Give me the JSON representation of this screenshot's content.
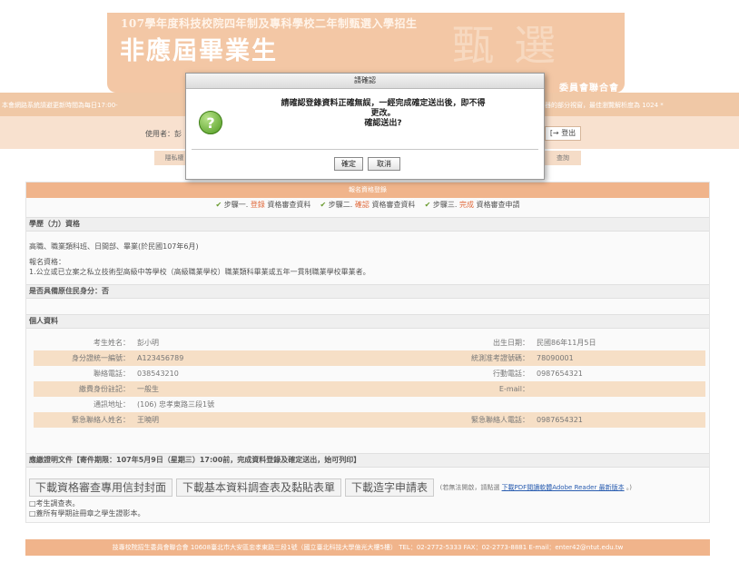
{
  "banner": {
    "subtitle": "107學年度科技校院四年制及專科學校二年制甄選入學招生",
    "title": "非應屆畢業生",
    "deco": "甄選",
    "council": "委員會聯合會"
  },
  "topbar": {
    "notice_left": "本會網路系統請避更新時間為每日17:00-",
    "notice_right": "器的部分視窗，最佳瀏覽解析度為 1024 *",
    "user_label": "使用者：彭",
    "logout": "登出",
    "privacy_tab": "隱私權",
    "query_tab": "查詢"
  },
  "main": {
    "reg_title": "報名資格登錄",
    "steps": {
      "s1_pre": "步驟一.",
      "s1_hl": "登錄",
      "s1_post": "資格審查資料",
      "s2_pre": "步驟二.",
      "s2_hl": "確認",
      "s2_post": "資格審查資料",
      "s3_pre": "步驟三.",
      "s3_hl": "完成",
      "s3_post": "資格審查申請"
    },
    "edu_head": "學歷（力）資格",
    "edu_line1": "高職、職業類科班、日間部、畢業(於民國107年6月)",
    "edu_line2": "報名資格：",
    "edu_line3": "1.公立或已立案之私立技術型高級中等學校（高級職業學校）職業類科畢業或五年一貫制職業學校畢業者。",
    "aboriginal": "是否具備原住民身分：否",
    "personal_head": "個人資料",
    "personal": {
      "name_label": "考生姓名：",
      "name": "彭小明",
      "birth_label": "出生日期：",
      "birth": "民國86年11月5日",
      "id_label": "身分證統一編號：",
      "id": "A123456789",
      "exam_label": "統測准考證號碼：",
      "exam": "78090001",
      "phone_label": "聯絡電話：",
      "phone": "038543210",
      "mobile_label": "行動電話：",
      "mobile": "0987654321",
      "fee_label": "繳費身份註記：",
      "fee": "一般生",
      "email_label": "E-mail：",
      "email": "",
      "addr_label": "通訊地址：",
      "addr": "(106) 忠孝東路三段1號",
      "ec_name_label": "緊急聯絡人姓名：",
      "ec_name": "王曉明",
      "ec_phone_label": "緊急聯絡人電話：",
      "ec_phone": "0987654321"
    },
    "docs_head": "應繳證明文件【寄件期限：107年5月9日（星期三）17:00前，完成資料登錄及確定送出，始可列印】",
    "btn_envelope": "下載資格審查專用信封封面",
    "btn_survey": "下載基本資料調查表及黏貼表單",
    "btn_apply": "下載造字申請表",
    "pdf_note_pre": "(若無法開啟，請點選",
    "pdf_link": "下載PDF閱讀軟體Adobe Reader 最新版本",
    "pdf_note_post": "。)",
    "doc1": "□考生調查表。",
    "doc2": "□蓋所有學期註冊章之學生證影本。"
  },
  "footer": "技專校院招生委員會聯合會 10608臺北市大安區忠孝東路三段1號（國立臺北科技大學億光大樓5樓） TEL：02-2772-5333 FAX：02-2773-8881 E-mail：enter42@ntut.edu.tw",
  "modal": {
    "title": "請確認",
    "line1": "請確認登錄資料正確無誤，一經完成確定送出後，即不得",
    "line2": "更改。",
    "line3": "確認送出?",
    "ok": "確定",
    "cancel": "取消"
  }
}
